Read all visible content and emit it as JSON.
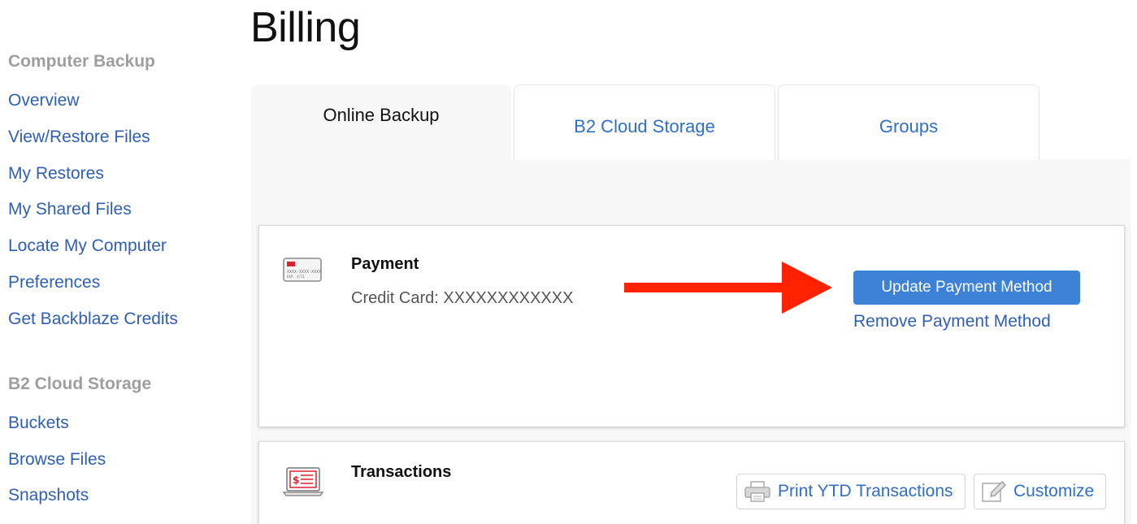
{
  "page_title": "Billing",
  "sidebar": {
    "sections": [
      {
        "heading": "Computer Backup",
        "items": [
          {
            "label": "Overview"
          },
          {
            "label": "View/Restore Files"
          },
          {
            "label": "My Restores"
          },
          {
            "label": "My Shared Files"
          },
          {
            "label": "Locate My Computer"
          },
          {
            "label": "Preferences"
          },
          {
            "label": "Get Backblaze Credits"
          }
        ]
      },
      {
        "heading": "B2 Cloud Storage",
        "items": [
          {
            "label": "Buckets"
          },
          {
            "label": "Browse Files"
          },
          {
            "label": "Snapshots"
          }
        ]
      }
    ]
  },
  "tabs": [
    {
      "label": "Online Backup",
      "active": true
    },
    {
      "label": "B2 Cloud Storage",
      "active": false
    },
    {
      "label": "Groups",
      "active": false
    }
  ],
  "payment": {
    "title": "Payment",
    "card_label": "Credit Card: XXXXXXXXXXXX",
    "card_icon_text": "XXXX-XXXX-XXXX",
    "card_icon_exp": "EXP. 4/21",
    "update_button": "Update Payment Method",
    "remove_link": "Remove Payment Method"
  },
  "transactions": {
    "title": "Transactions",
    "icon_symbol": "$",
    "print_button": "Print YTD Transactions",
    "customize_button": "Customize"
  },
  "colors": {
    "link": "#2f5fb3",
    "primary_button": "#3d82d6",
    "arrow": "#ff2200",
    "muted_heading": "#9e9e9e"
  }
}
